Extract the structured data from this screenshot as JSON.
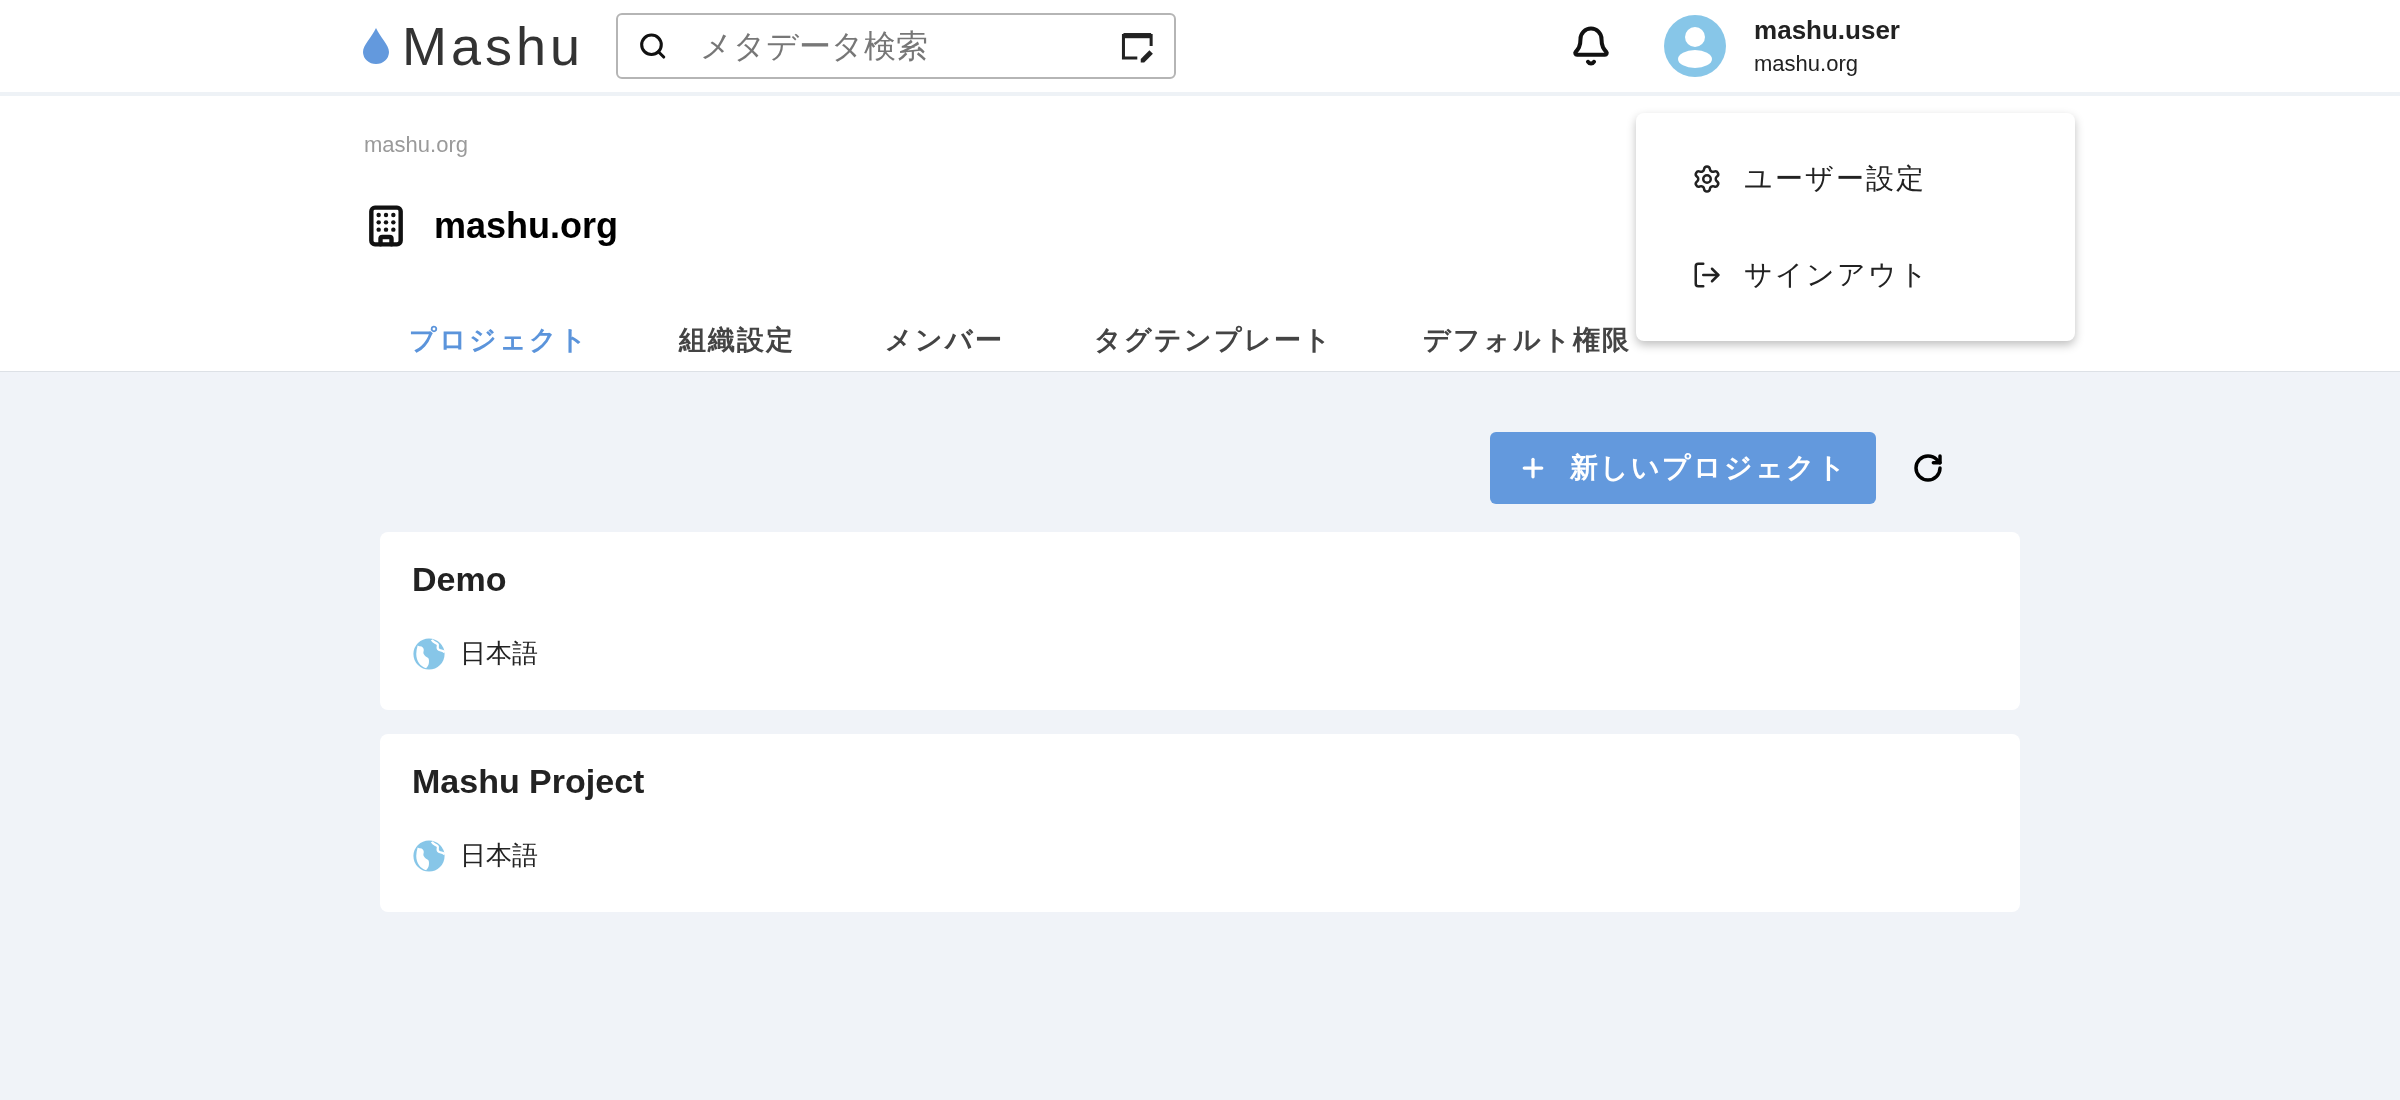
{
  "header": {
    "logo": "Mashu",
    "search": {
      "placeholder": "メタデータ検索"
    },
    "user": {
      "name": "mashu.user",
      "org": "mashu.org"
    }
  },
  "breadcrumb": "mashu.org",
  "org_title": "mashu.org",
  "tabs": [
    {
      "label": "プロジェクト",
      "selected": true
    },
    {
      "label": "組織設定",
      "selected": false
    },
    {
      "label": "メンバー",
      "selected": false
    },
    {
      "label": "タグテンプレート",
      "selected": false
    },
    {
      "label": "デフォルト権限",
      "selected": false
    }
  ],
  "new_project_button": "新しいプロジェクト",
  "projects": [
    {
      "name": "Demo",
      "language": "日本語"
    },
    {
      "name": "Mashu Project",
      "language": "日本語"
    }
  ],
  "user_menu": {
    "items": [
      {
        "kind": "settings",
        "label": "ユーザー設定"
      },
      {
        "kind": "signout",
        "label": "サインアウト"
      }
    ]
  }
}
